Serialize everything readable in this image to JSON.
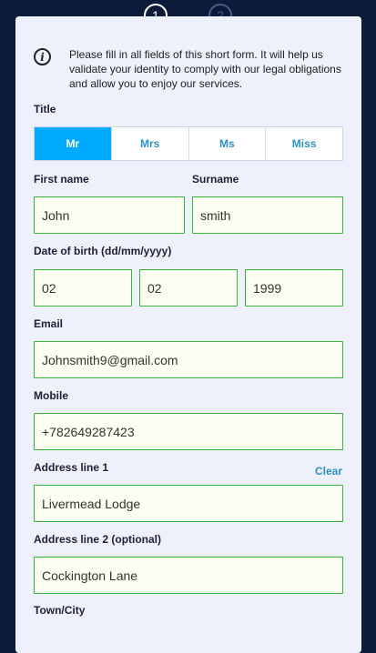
{
  "steps": [
    "1",
    "2"
  ],
  "info": {
    "text": "Please fill in all fields of this short form. It will help us validate your identity to comply with our legal obligations and allow you to enjoy our services."
  },
  "title": {
    "label": "Title",
    "options": [
      "Mr",
      "Mrs",
      "Ms",
      "Miss"
    ],
    "selected": "Mr"
  },
  "first_name": {
    "label": "First name",
    "value": "John"
  },
  "surname": {
    "label": "Surname",
    "value": "smith"
  },
  "dob": {
    "label": "Date of birth (dd/mm/yyyy)",
    "day": "02",
    "month": "02",
    "year": "1999"
  },
  "email": {
    "label": "Email",
    "value": "Johnsmith9@gmail.com"
  },
  "mobile": {
    "label": "Mobile",
    "value": "+782649287423"
  },
  "address1": {
    "label": "Address line 1",
    "clear": "Clear",
    "value": "Livermead Lodge"
  },
  "address2": {
    "label": "Address line 2 (optional)",
    "value": "Cockington Lane"
  },
  "town": {
    "label": "Town/City"
  },
  "colors": {
    "accent": "#00aaff",
    "valid_border": "#35b535",
    "link": "#2b92c6",
    "page_bg": "#0c1b3a"
  }
}
